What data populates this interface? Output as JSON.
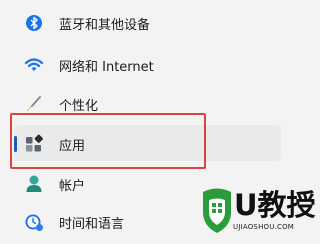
{
  "nav_items": [
    {
      "label": "蓝牙和其他设备",
      "icon": "bluetooth-icon",
      "selected": false
    },
    {
      "label": "网络和 Internet",
      "icon": "wifi-icon",
      "selected": false
    },
    {
      "label": "个性化",
      "icon": "brush-icon",
      "selected": false
    },
    {
      "label": "应用",
      "icon": "apps-icon",
      "selected": true
    },
    {
      "label": "帐户",
      "icon": "account-icon",
      "selected": false
    },
    {
      "label": "时间和语言",
      "icon": "time-language-icon",
      "selected": false
    }
  ],
  "colors": {
    "accent": "#1a5fb4",
    "highlight_box": "#d9443f",
    "watermark_green": "#2a9d3a"
  },
  "watermark": {
    "title": "U教授",
    "url": "UJIAOSHOU.COM"
  }
}
